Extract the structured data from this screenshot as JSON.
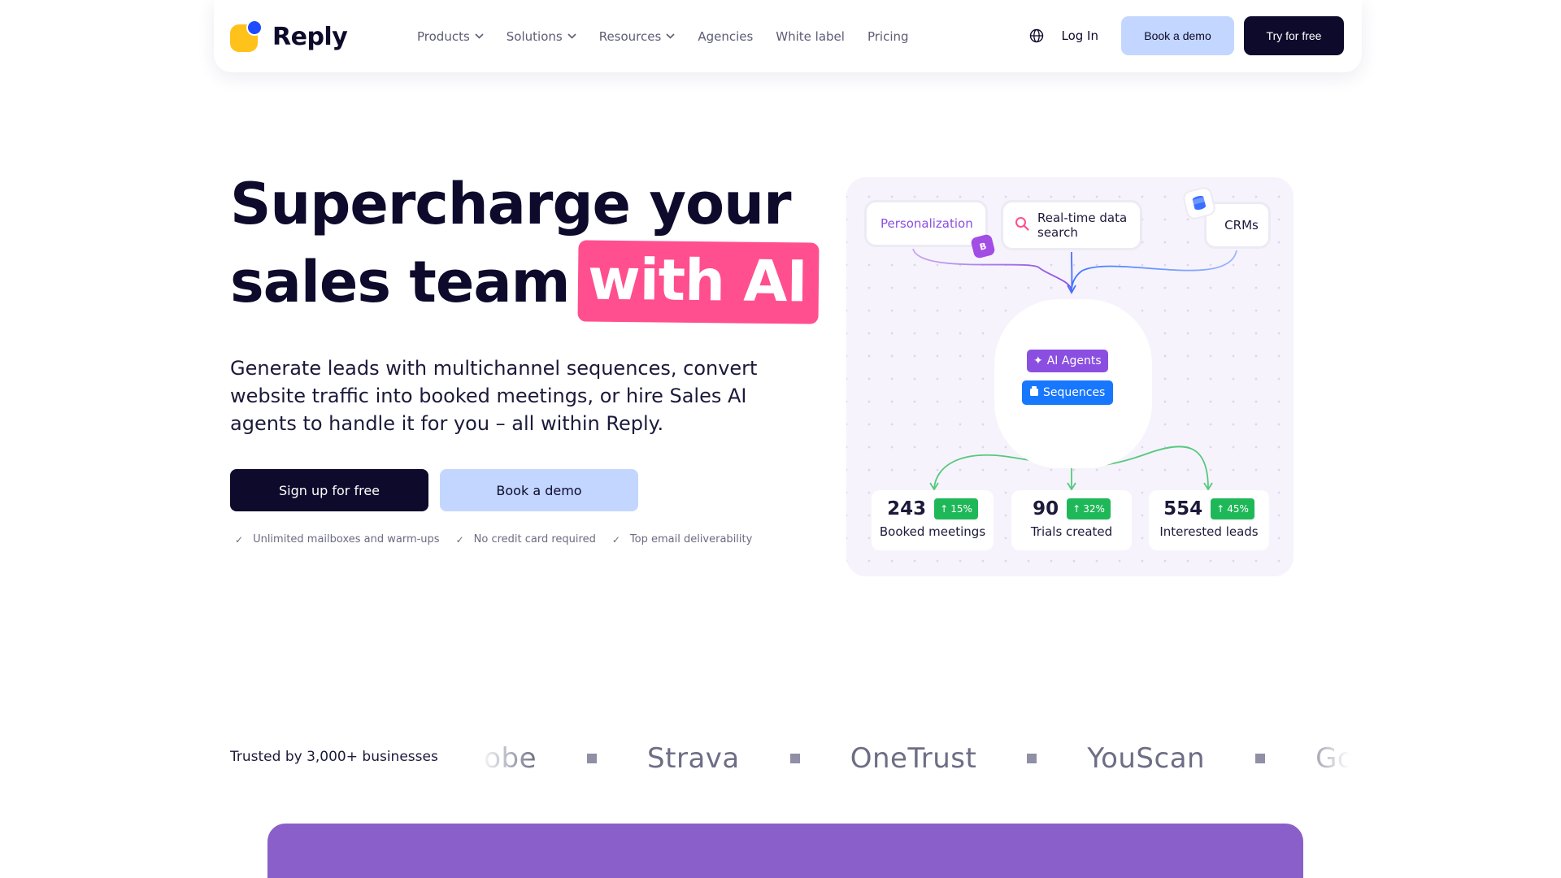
{
  "nav": {
    "brand": "Reply",
    "links": [
      {
        "label": "Products",
        "dropdown": true
      },
      {
        "label": "Solutions",
        "dropdown": true
      },
      {
        "label": "Resources",
        "dropdown": true
      },
      {
        "label": "Agencies",
        "dropdown": false
      },
      {
        "label": "White label",
        "dropdown": false
      },
      {
        "label": "Pricing",
        "dropdown": false
      }
    ],
    "login": "Log In",
    "book_demo": "Book a demo",
    "try_free": "Try for free"
  },
  "hero": {
    "title_line1": "Supercharge your",
    "title_line2": "sales team",
    "title_highlight": "with AI",
    "subtitle": "Generate leads with multichannel sequences, convert website traffic into booked meetings, or hire Sales AI agents to handle it for you – all within Reply.",
    "signup": "Sign up for free",
    "book_demo": "Book a demo",
    "checks": [
      "Unlimited mailboxes and warm-ups",
      "No credit card required",
      "Top email deliverability"
    ]
  },
  "illustration": {
    "personalization": "Personalization",
    "realtime": "Real-time data search",
    "crms": "CRMs",
    "ai_agents": "AI Agents",
    "sequences": "Sequences",
    "stats": [
      {
        "value": "243",
        "change": "15%",
        "label": "Booked meetings"
      },
      {
        "value": "90",
        "change": "32%",
        "label": "Trials created"
      },
      {
        "value": "554",
        "change": "45%",
        "label": "Interested leads"
      }
    ],
    "colors": {
      "purple": "#8a4fe0",
      "blue": "#1877ff",
      "green": "#1fb858"
    }
  },
  "trusted": {
    "text": "Trusted by 3,000+ businesses",
    "logos": [
      "Adobe",
      "Strava",
      "OneTrust",
      "YouScan",
      "Gorgias"
    ]
  },
  "colors": {
    "navy": "#0d0a2c",
    "pink": "#ff4f8e",
    "light_blue": "#c3d6ff",
    "section_purple": "#8a5fc9"
  }
}
